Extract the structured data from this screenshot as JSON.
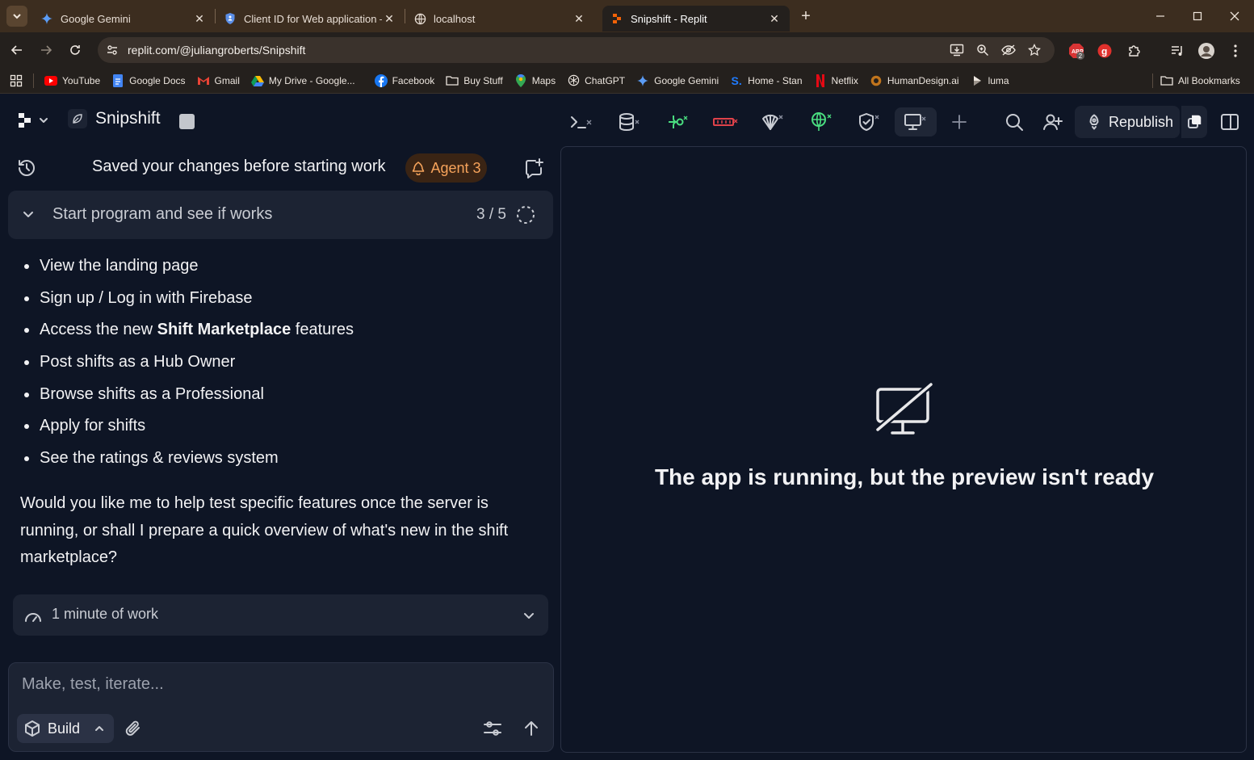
{
  "browser": {
    "tabs": [
      {
        "title": "Google Gemini",
        "icon": "gemini-icon"
      },
      {
        "title": "Client ID for Web application – G",
        "icon": "shield-icon"
      },
      {
        "title": "localhost",
        "icon": "globe-icon"
      },
      {
        "title": "Snipshift - Replit",
        "icon": "replit-icon",
        "active": true
      }
    ],
    "url": "replit.com/@juliangroberts/Snipshift",
    "badge_count": "2",
    "bookmarks": [
      {
        "label": "YouTube",
        "icon": "youtube-icon"
      },
      {
        "label": "Google Docs",
        "icon": "docs-icon"
      },
      {
        "label": "Gmail",
        "icon": "gmail-icon"
      },
      {
        "label": "My Drive - Google...",
        "icon": "drive-icon"
      },
      {
        "label": "Facebook",
        "icon": "facebook-icon"
      },
      {
        "label": "Buy Stuff",
        "icon": "folder-icon"
      },
      {
        "label": "Maps",
        "icon": "maps-icon"
      },
      {
        "label": "ChatGPT",
        "icon": "chatgpt-icon"
      },
      {
        "label": "Google Gemini",
        "icon": "gemini-icon"
      },
      {
        "label": "Home - Stan",
        "icon": "stan-icon"
      },
      {
        "label": "Netflix",
        "icon": "netflix-icon"
      },
      {
        "label": "HumanDesign.ai",
        "icon": "humandesign-icon"
      },
      {
        "label": "luma",
        "icon": "luma-icon"
      }
    ],
    "all_bookmarks": "All Bookmarks"
  },
  "app": {
    "project_name": "Snipshift",
    "republish_label": "Republish",
    "chat": {
      "saved_text": "Saved your changes before starting work",
      "agent_badge": "Agent 3",
      "task": {
        "label": "Start program and see if works",
        "progress": "3 / 5"
      },
      "steps": [
        {
          "text": "View the landing page"
        },
        {
          "text": "Sign up / Log in with Firebase"
        },
        {
          "before": "Access the new ",
          "bold": "Shift Marketplace",
          "after": " features"
        },
        {
          "text": "Post shifts as a Hub Owner"
        },
        {
          "text": "Browse shifts as a Professional"
        },
        {
          "text": "Apply for shifts"
        },
        {
          "text": "See the ratings & reviews system"
        }
      ],
      "paragraph": "Would you like me to help test specific features once the server is running, or shall I prepare a quick overview of what's new in the shift marketplace?",
      "work_label": "1 minute of work",
      "composer_placeholder": "Make, test, iterate...",
      "build_label": "Build"
    },
    "preview": {
      "message": "The app is running, but the preview isn't ready"
    }
  }
}
